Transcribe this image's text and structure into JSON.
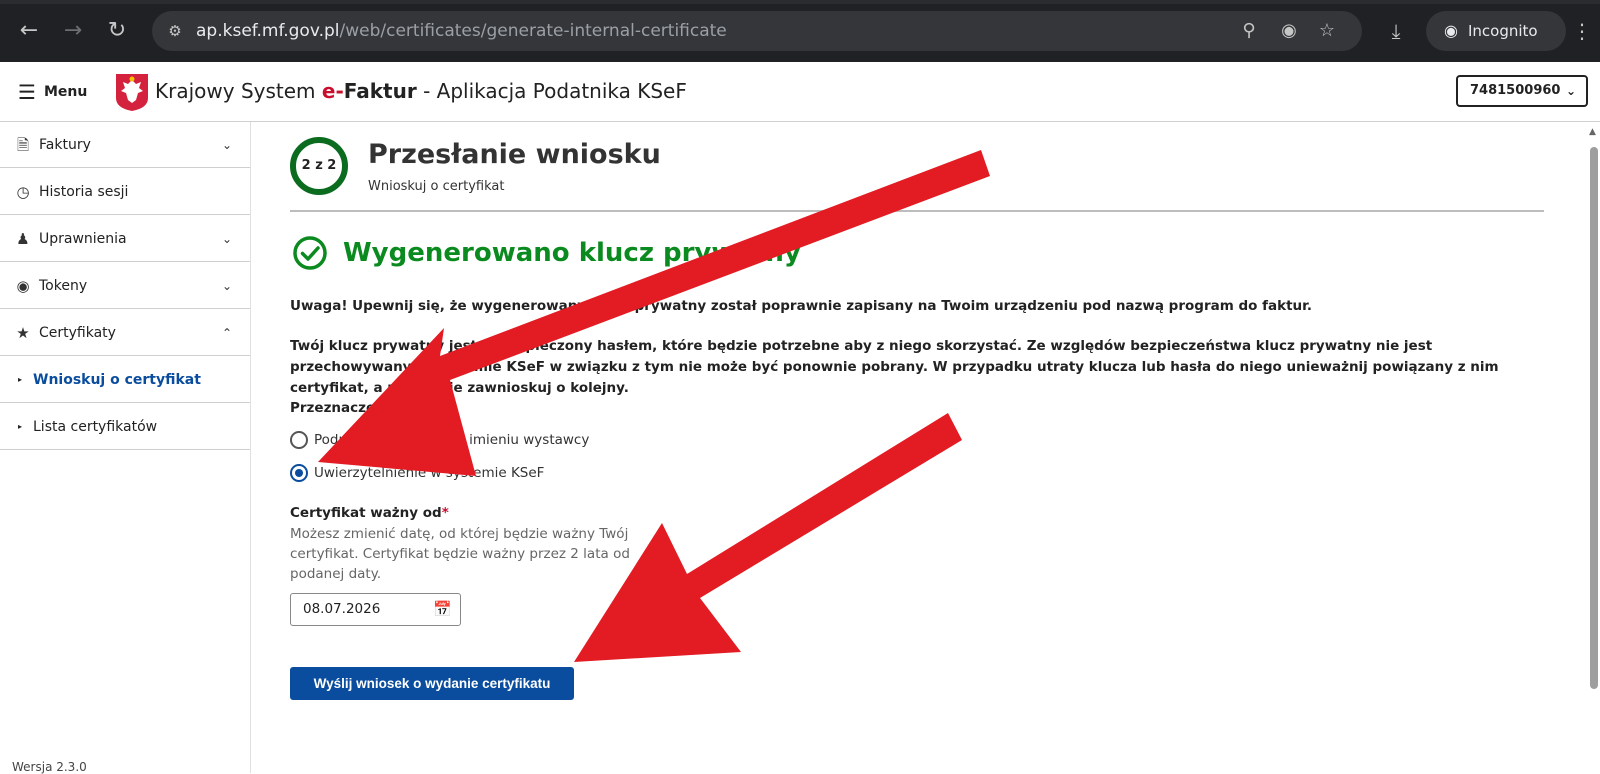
{
  "browser": {
    "url_host": "ap.ksef.mf.gov.pl",
    "url_path": "/web/certificates/generate-internal-certificate",
    "incognito_label": "Incognito"
  },
  "header": {
    "menu_label": "Menu",
    "title_prefix": "Krajowy System",
    "title_e": "e-",
    "title_faktur": "Faktur",
    "title_suffix": " - Aplikacja Podatnika KSeF",
    "nip_value": "7481500960"
  },
  "sidebar": {
    "items": [
      {
        "label": "Faktury"
      },
      {
        "label": "Historia sesji"
      },
      {
        "label": "Uprawnienia"
      },
      {
        "label": "Tokeny"
      },
      {
        "label": "Certyfikaty"
      }
    ],
    "sub_items": [
      {
        "label": "Wnioskuj o certyfikat"
      },
      {
        "label": "Lista certyfikatów"
      }
    ],
    "version": "Wersja 2.3.0"
  },
  "main": {
    "step": "2 z 2",
    "title": "Przesłanie wniosku",
    "subtitle": "Wnioskuj o certyfikat",
    "success_title": "Wygenerowano klucz prywatny",
    "warning": "Uwaga! Upewnij się, że wygenerowany klucz prywatny został poprawnie zapisany na Twoim urządzeniu pod nazwą program do faktur.",
    "info": "Twój klucz prywatny jest zabezpieczony hasłem, które będzie potrzebne aby z niego skorzystać. Ze względów bezpieczeństwa klucz prywatny nie jest przechowywany w systemie KSeF w związku z tym nie może być ponownie pobrany. W przypadku utraty klucza lub hasła do niego unieważnij powiązany z nim certyfikat, a następnie zawnioskuj o kolejny.",
    "purpose_label": "Przeznaczenie",
    "radio_options": [
      {
        "label": "Podpis dokumentów w imieniu wystawcy",
        "checked": false
      },
      {
        "label": "Uwierzytelnienie w systemie KSeF",
        "checked": true
      }
    ],
    "valid_from_label": "Certyfikat ważny od",
    "required_mark": "*",
    "valid_from_help": "Możesz zmienić datę, od której będzie ważny Twój certyfikat. Certyfikat będzie ważny przez 2 lata od podanej daty.",
    "valid_from_value": "08.07.2026",
    "submit_label": "Wyślij wniosek o wydanie certyfikatu"
  },
  "colors": {
    "primary": "#0a4d9e",
    "success": "#0b8a1f",
    "annotation_arrow": "#e31b23"
  }
}
